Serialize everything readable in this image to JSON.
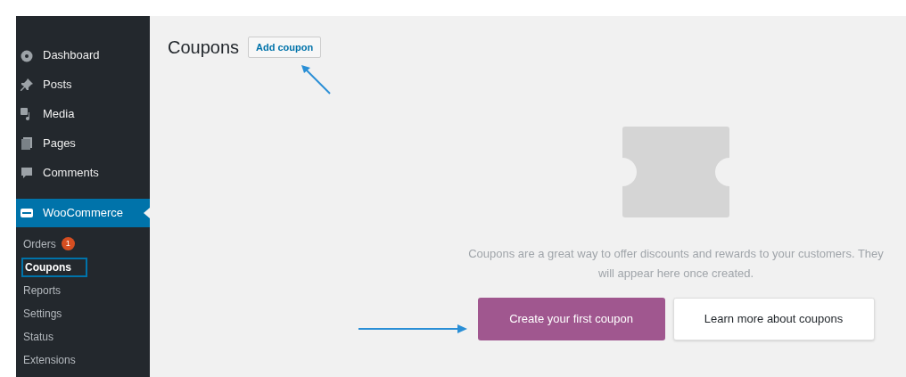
{
  "sidebar": {
    "menu": [
      {
        "label": "Dashboard",
        "selected": false
      },
      {
        "label": "Posts",
        "selected": false
      },
      {
        "label": "Media",
        "selected": false
      },
      {
        "label": "Pages",
        "selected": false
      },
      {
        "label": "Comments",
        "selected": false
      },
      {
        "label": "WooCommerce",
        "selected": true
      }
    ],
    "submenu": [
      {
        "label": "Orders",
        "badge": "1",
        "selected": false
      },
      {
        "label": "Coupons",
        "selected": true
      },
      {
        "label": "Reports",
        "selected": false
      },
      {
        "label": "Settings",
        "selected": false
      },
      {
        "label": "Status",
        "selected": false
      },
      {
        "label": "Extensions",
        "selected": false
      }
    ]
  },
  "page": {
    "title": "Coupons",
    "add_button": "Add coupon"
  },
  "empty_state": {
    "message": "Coupons are a great way to offer discounts and rewards to your customers. They will appear here once created.",
    "primary_button": "Create your first coupon",
    "secondary_button": "Learn more about coupons"
  }
}
